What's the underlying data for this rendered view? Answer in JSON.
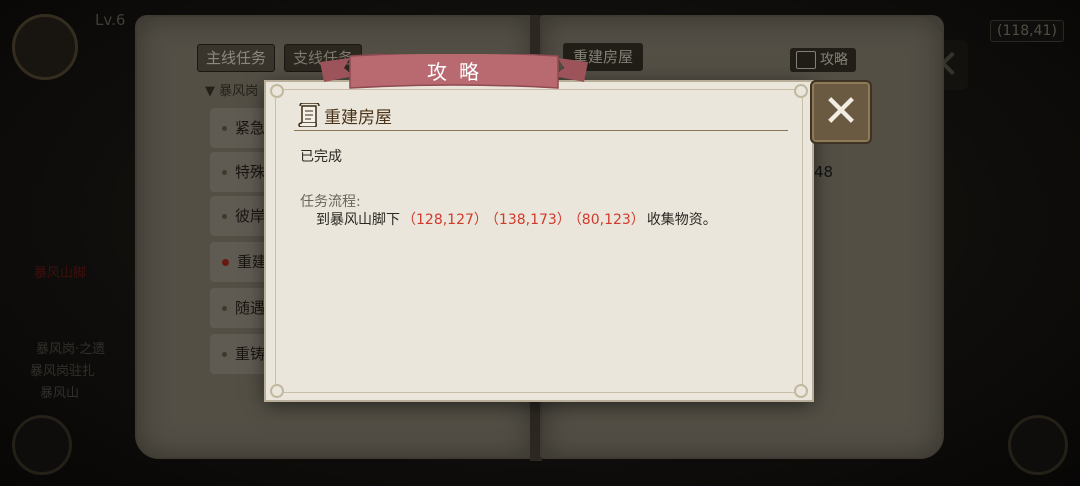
{
  "background": {
    "coords_label": "(118,41)",
    "level_label": "Lv.6",
    "tabs": [
      {
        "label": "主线任务",
        "active": true
      },
      {
        "label": "支线任务",
        "active": false
      }
    ],
    "section_label": "▼ 暴风岗",
    "quest_items": [
      {
        "label": "紧急",
        "active": false
      },
      {
        "label": "特殊",
        "active": false
      },
      {
        "label": "彼岸",
        "active": false
      },
      {
        "label": "重建",
        "active": true
      },
      {
        "label": "随遇",
        "active": false
      },
      {
        "label": "重铸",
        "active": false
      }
    ],
    "right_title": "重建房屋",
    "guide_button": "攻略",
    "right_value": "48",
    "left_red_text": "暴风山脚",
    "left_lines": [
      "暴风岗·之遗",
      "暴风岗驻扎",
      "暴风山"
    ]
  },
  "modal": {
    "title": "攻略",
    "heading": "重建房屋",
    "status": "已完成",
    "flow_label": "任务流程:",
    "flow_prefix": "到暴风山脚下",
    "flow_coords": [
      "（128,127）",
      "（138,173）",
      "（80,123）"
    ],
    "flow_suffix": "收集物资。",
    "close_label": "✕"
  },
  "colors": {
    "ribbon": "#b86a70",
    "coord_red": "#d03a2c",
    "modal_bg": "#ebe6db"
  }
}
